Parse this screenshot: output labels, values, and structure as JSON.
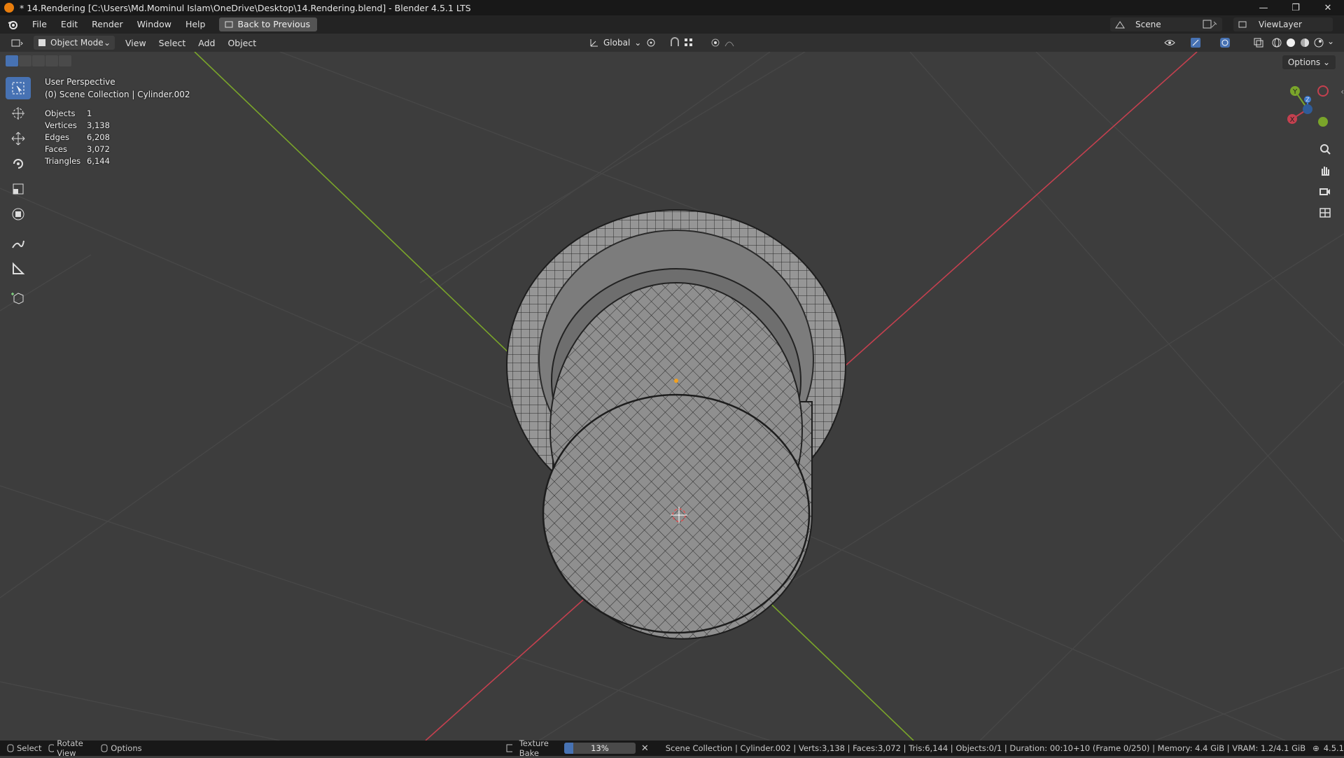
{
  "window": {
    "title": "* 14.Rendering [C:\\Users\\Md.Mominul Islam\\OneDrive\\Desktop\\14.Rendering.blend] - Blender 4.5.1 LTS",
    "minimize": "—",
    "maximize": "❐",
    "close": "✕"
  },
  "menubar": {
    "items": [
      "File",
      "Edit",
      "Render",
      "Window",
      "Help"
    ],
    "back_button": "Back to Previous",
    "scene_label": "Scene",
    "viewlayer_label": "ViewLayer"
  },
  "header": {
    "mode": "Object Mode",
    "menus": [
      "View",
      "Select",
      "Add",
      "Object"
    ],
    "orientation": "Global",
    "options": "Options"
  },
  "viewport": {
    "perspective": "User Perspective",
    "collection": "(0) Scene Collection | Cylinder.002",
    "stats": [
      {
        "label": "Objects",
        "value": "1"
      },
      {
        "label": "Vertices",
        "value": "3,138"
      },
      {
        "label": "Edges",
        "value": "6,208"
      },
      {
        "label": "Faces",
        "value": "3,072"
      },
      {
        "label": "Triangles",
        "value": "6,144"
      }
    ],
    "gizmo": {
      "x": "X",
      "y": "Y",
      "z": "Z"
    }
  },
  "statusbar": {
    "select": "Select",
    "rotate": "Rotate View",
    "options": "Options",
    "job": "Texture Bake",
    "progress_percent": 13,
    "progress_label": "13%",
    "info": "Scene Collection | Cylinder.002 | Verts:3,138 | Faces:3,072 | Tris:6,144 | Objects:0/1 | Duration: 00:10+10 (Frame 0/250) | Memory: 4.4 GiB | VRAM: 1.2/4.1 GiB",
    "version": "4.5.1"
  },
  "colors": {
    "accent": "#4772b3",
    "x_axis": "#c4404f",
    "y_axis": "#7aa52a",
    "z_axis": "#3d7bcf"
  }
}
